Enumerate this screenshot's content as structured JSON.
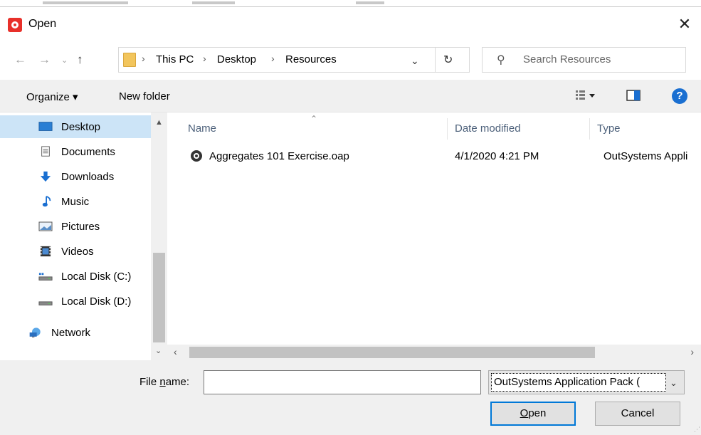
{
  "window": {
    "title": "Open",
    "close_glyph": "✕"
  },
  "address": {
    "breadcrumbs": [
      "This PC",
      "Desktop",
      "Resources"
    ],
    "separator": "›"
  },
  "search": {
    "placeholder": "Search Resources"
  },
  "commands": {
    "organize_label": "Organize ▾",
    "new_folder_label": "New folder",
    "help_label": "?"
  },
  "nav_pane": {
    "items": [
      {
        "label": "Desktop",
        "icon": "desktop-icon",
        "selected": true
      },
      {
        "label": "Documents",
        "icon": "documents-icon"
      },
      {
        "label": "Downloads",
        "icon": "downloads-icon"
      },
      {
        "label": "Music",
        "icon": "music-icon"
      },
      {
        "label": "Pictures",
        "icon": "pictures-icon"
      },
      {
        "label": "Videos",
        "icon": "videos-icon"
      },
      {
        "label": "Local Disk (C:)",
        "icon": "local-disk-icon"
      },
      {
        "label": "Local Disk (D:)",
        "icon": "local-disk-icon"
      },
      {
        "label": "Network",
        "icon": "network-icon"
      }
    ]
  },
  "file_list": {
    "columns": [
      "Name",
      "Date modified",
      "Type"
    ],
    "rows": [
      {
        "name": "Aggregates 101 Exercise.oap",
        "date": "4/1/2020 4:21 PM",
        "type": "OutSystems Appli"
      }
    ]
  },
  "footer": {
    "file_name_label_pre": "File ",
    "file_name_label_u": "n",
    "file_name_label_post": "ame:",
    "file_name_value": "",
    "file_type_value": "OutSystems Application Pack (",
    "open_u": "O",
    "open_rest": "pen",
    "cancel_label": "Cancel"
  },
  "colors": {
    "accent": "#0078d7",
    "selection": "#cce4f7",
    "app_icon": "#e8302a",
    "help_icon": "#1a6fd1"
  }
}
